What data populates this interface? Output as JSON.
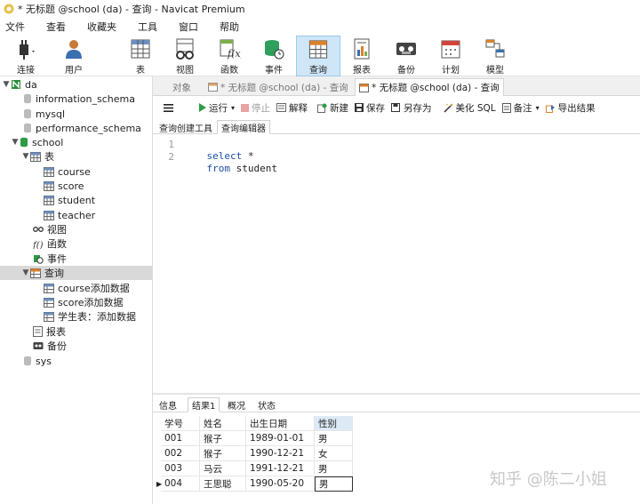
{
  "window": {
    "title": "* 无标题 @school (da) - 查询 - Navicat Premium"
  },
  "menu": [
    "文件",
    "查看",
    "收藏夹",
    "工具",
    "窗口",
    "帮助"
  ],
  "toolbar": {
    "connect": "连接",
    "user": "用户",
    "table": "表",
    "view": "视图",
    "function": "函数",
    "event": "事件",
    "query": "查询",
    "report": "报表",
    "backup": "备份",
    "schedule": "计划",
    "model": "模型"
  },
  "tree": {
    "connection": "da",
    "databases": [
      "information_schema",
      "mysql",
      "performance_schema",
      "school",
      "sys"
    ],
    "tables_label": "表",
    "tables": [
      "course",
      "score",
      "student",
      "teacher"
    ],
    "views_label": "视图",
    "functions_label": "函数",
    "events_label": "事件",
    "queries_label": "查询",
    "queries": [
      "course添加数据",
      "score添加数据",
      "学生表：添加数据"
    ],
    "reports_label": "报表",
    "backups_label": "备份"
  },
  "tabs": {
    "objects": "对象",
    "tab1": "* 无标题 @school (da) - 查询",
    "tab2": "* 无标题 @school (da) - 查询"
  },
  "query_toolbar": {
    "run": "运行",
    "stop": "停止",
    "explain": "解释",
    "new": "新建",
    "save": "保存",
    "save_as": "另存为",
    "beautify": "美化 SQL",
    "note": "备注",
    "export": "导出结果"
  },
  "editor_tabs": {
    "builder": "查询创建工具",
    "editor": "查询编辑器"
  },
  "editor": {
    "lines": [
      {
        "num": "1",
        "kw": "select",
        "rest": " *"
      },
      {
        "num": "2",
        "kw": "from",
        "rest": " student"
      }
    ]
  },
  "result_tabs": {
    "info": "信息",
    "result1": "结果1",
    "overview": "概况",
    "status": "状态"
  },
  "result": {
    "columns": [
      "学号",
      "姓名",
      "出生日期",
      "性别"
    ],
    "rows": [
      [
        "001",
        "猴子",
        "1989-01-01",
        "男"
      ],
      [
        "002",
        "猴子",
        "1990-12-21",
        "女"
      ],
      [
        "003",
        "马云",
        "1991-12-21",
        "男"
      ],
      [
        "004",
        "王思聪",
        "1990-05-20",
        "男"
      ]
    ]
  },
  "watermark": "知乎 @陈二小姐",
  "colors": {
    "keyword": "#1c4fa8",
    "active_toolbar": "#cfe6f8",
    "selected_node": "#d9d9d9"
  }
}
